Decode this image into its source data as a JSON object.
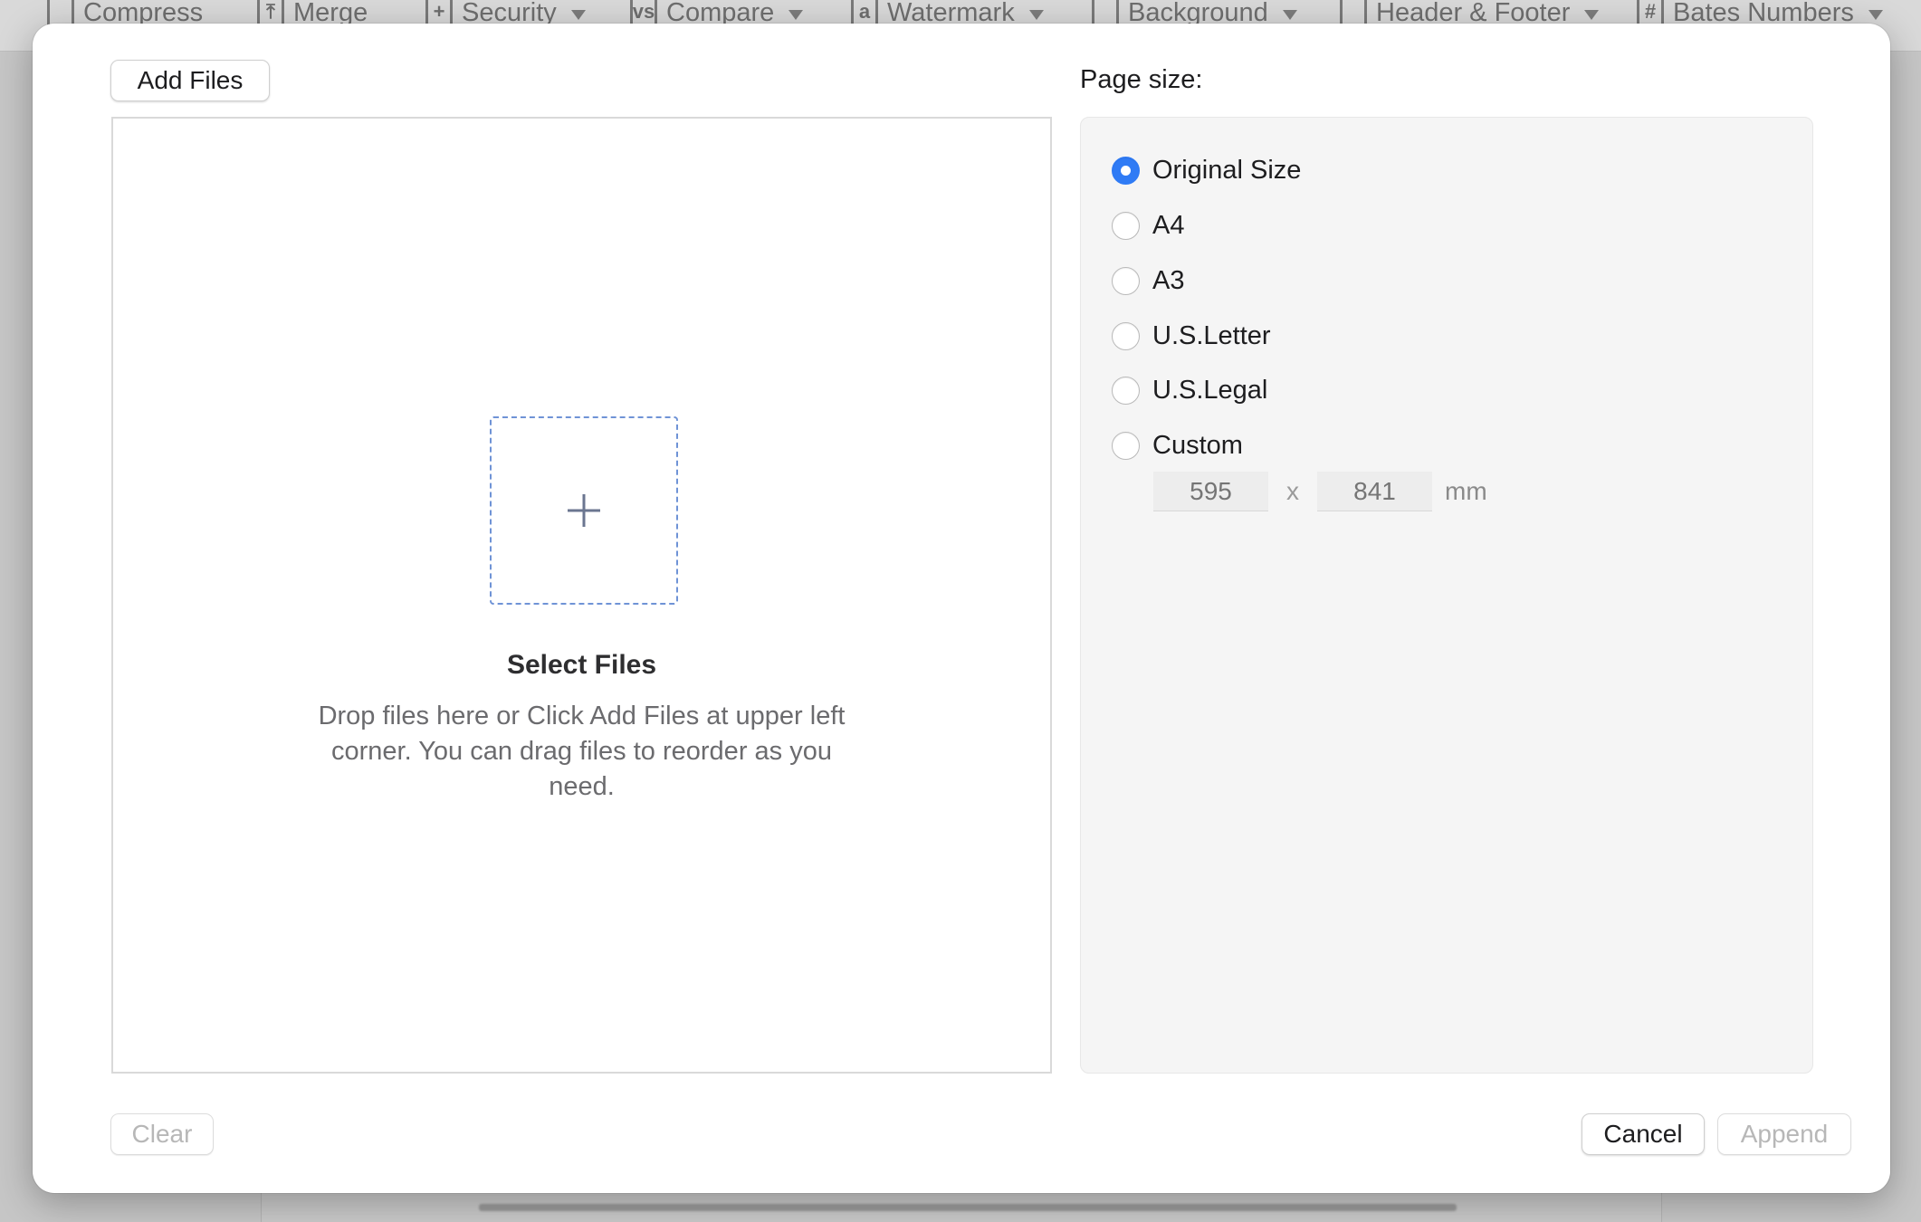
{
  "toolbar": {
    "items": [
      {
        "label": "Compress",
        "icon": "compress-icon",
        "glyph": "",
        "caret": false
      },
      {
        "label": "Merge",
        "icon": "merge-icon",
        "glyph": "⤒",
        "caret": false
      },
      {
        "label": "Security",
        "icon": "security-icon",
        "glyph": "+",
        "caret": true
      },
      {
        "label": "Compare",
        "icon": "compare-icon",
        "glyph": "vs",
        "caret": true
      },
      {
        "label": "Watermark",
        "icon": "watermark-icon",
        "glyph": "a",
        "caret": true
      },
      {
        "label": "Background",
        "icon": "background-icon",
        "glyph": "",
        "caret": true
      },
      {
        "label": "Header & Footer",
        "icon": "header-footer-icon",
        "glyph": "",
        "caret": true
      },
      {
        "label": "Bates Numbers",
        "icon": "bates-numbers-icon",
        "glyph": "#",
        "caret": true
      }
    ]
  },
  "dialog": {
    "add_files_label": "Add Files",
    "drop_area": {
      "icon": "plus-icon",
      "title": "Select Files",
      "description": "Drop files here or Click Add Files at upper left corner. You can drag files to reorder as you need."
    },
    "page_size": {
      "label": "Page size:",
      "selected": "Original Size",
      "options": [
        "Original Size",
        "A4",
        "A3",
        "U.S.Letter",
        "U.S.Legal",
        "Custom"
      ],
      "custom": {
        "width_placeholder": "595",
        "height_placeholder": "841",
        "separator": "x",
        "unit": "mm"
      }
    },
    "footer": {
      "clear_label": "Clear",
      "cancel_label": "Cancel",
      "append_label": "Append"
    }
  },
  "colors": {
    "accent": "#2f7bf5",
    "dashed_border": "#6f93d6",
    "panel_bg": "#f5f5f5"
  }
}
